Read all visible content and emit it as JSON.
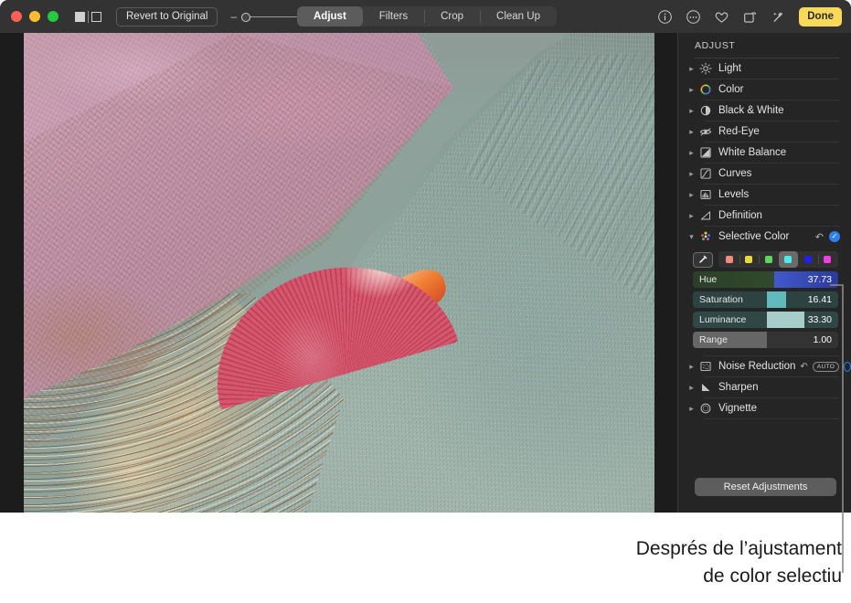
{
  "window": {
    "toolbar": {
      "traffic_lights": [
        "close",
        "minimize",
        "zoom"
      ],
      "view_mode_label": "split-view-toggle",
      "revert_label": "Revert to Original",
      "zoom_minus": "–",
      "zoom_plus": "+",
      "tabs": [
        {
          "label": "Adjust",
          "active": true
        },
        {
          "label": "Filters",
          "active": false
        },
        {
          "label": "Crop",
          "active": false
        },
        {
          "label": "Clean Up",
          "active": false
        }
      ],
      "right_icons": [
        {
          "name": "info-icon",
          "glyph": "i"
        },
        {
          "name": "more-options-icon",
          "glyph": "…"
        },
        {
          "name": "favorite-heart-icon",
          "glyph": "♡"
        },
        {
          "name": "rotate-icon",
          "glyph": "⎙"
        },
        {
          "name": "auto-enhance-icon",
          "glyph": "✦"
        }
      ],
      "done_label": "Done"
    }
  },
  "sidebar": {
    "title": "ADJUST",
    "items": [
      {
        "label": "Light",
        "icon": "sun-icon",
        "expanded": false
      },
      {
        "label": "Color",
        "icon": "color-wheel-icon",
        "expanded": false
      },
      {
        "label": "Black & White",
        "icon": "half-circle-icon",
        "expanded": false
      },
      {
        "label": "Red-Eye",
        "icon": "eye-slash-icon",
        "expanded": false
      },
      {
        "label": "White Balance",
        "icon": "white-balance-icon",
        "expanded": false
      },
      {
        "label": "Curves",
        "icon": "curves-icon",
        "expanded": false
      },
      {
        "label": "Levels",
        "icon": "levels-icon",
        "expanded": false
      },
      {
        "label": "Definition",
        "icon": "definition-icon",
        "expanded": false
      }
    ],
    "selective_color": {
      "label": "Selective Color",
      "icon": "selective-color-icon",
      "expanded": true,
      "reset_icon": "undo-icon",
      "enabled_icon": "checkmark-icon",
      "eyedropper_icon": "eyedropper-icon",
      "swatches": [
        {
          "name": "red",
          "color": "#f08a82",
          "selected": false
        },
        {
          "name": "yellow",
          "color": "#e8d83c",
          "selected": false
        },
        {
          "name": "green",
          "color": "#5fd45f",
          "selected": false
        },
        {
          "name": "cyan",
          "color": "#4fe9ea",
          "selected": true
        },
        {
          "name": "blue",
          "color": "#2222e0",
          "selected": false
        },
        {
          "name": "magenta",
          "color": "#ef3fe0",
          "selected": false
        }
      ],
      "sliders": [
        {
          "label": "Hue",
          "value": "37.73",
          "fill_percent": 56,
          "track_left": "#2c4029",
          "track_right": "#1e2a5e",
          "fill_color": "#3d5bd0"
        },
        {
          "label": "Saturation",
          "value": "16.41",
          "fill_percent": 56,
          "track_left": "#2c4341",
          "track_right": "#2c4341",
          "fill_color": "#5fb9bd"
        },
        {
          "label": "Luminance",
          "value": "33.30",
          "fill_percent": 56,
          "track_left": "#2f4745",
          "track_right": "#2f4745",
          "fill_color": "#a7cdcb"
        },
        {
          "label": "Range",
          "value": "1.00",
          "fill_percent": 56,
          "track_left": "#333333",
          "track_right": "#333333",
          "fill_color": "#6e6e6e"
        }
      ]
    },
    "items_after": [
      {
        "label": "Noise Reduction",
        "icon": "noise-reduction-icon",
        "expanded": false,
        "has_reset": true,
        "auto_badge": "AUTO",
        "has_toggle": true
      },
      {
        "label": "Sharpen",
        "icon": "sharpen-icon",
        "expanded": false
      },
      {
        "label": "Vignette",
        "icon": "vignette-icon",
        "expanded": false
      }
    ],
    "reset_button": "Reset Adjustments"
  },
  "callout": {
    "line1": "Després de l’ajustament",
    "line2": "de color selectiu"
  },
  "colors": {
    "accent_yellow": "#f8d959",
    "accent_blue": "#2f7ff0",
    "toolbar_bg": "#333333",
    "sidebar_bg": "#252525",
    "canvas_bg": "#1c1c1c"
  }
}
